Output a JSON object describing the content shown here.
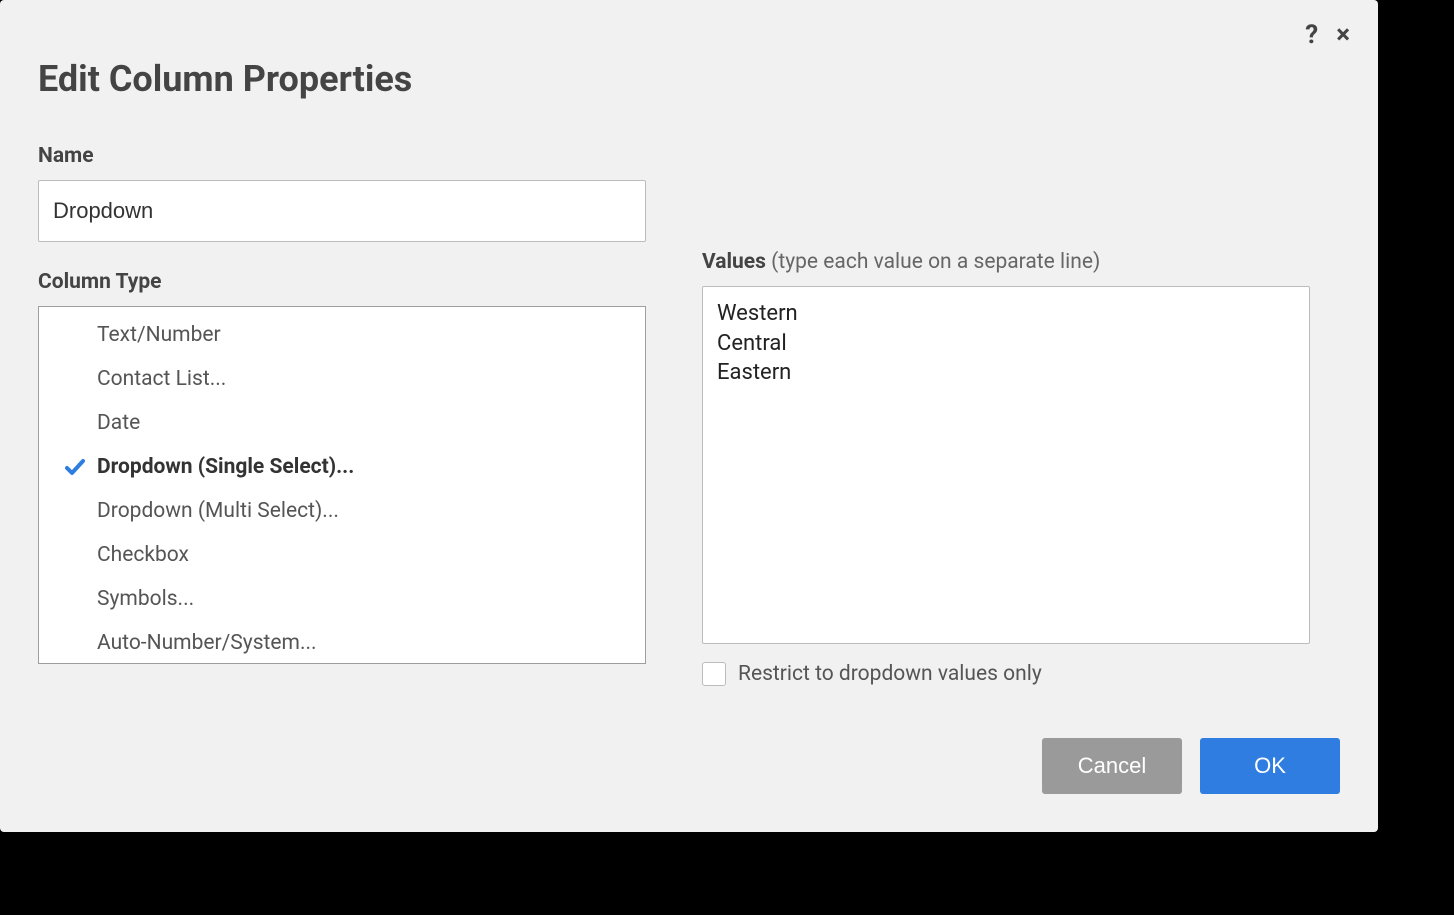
{
  "dialog": {
    "title": "Edit Column Properties",
    "help_icon": "?",
    "close_icon": "×"
  },
  "name_field": {
    "label": "Name",
    "value": "Dropdown"
  },
  "column_type": {
    "label": "Column Type",
    "selected_index": 3,
    "items": [
      "Text/Number",
      "Contact List...",
      "Date",
      "Dropdown (Single Select)...",
      "Dropdown (Multi Select)...",
      "Checkbox",
      "Symbols...",
      "Auto-Number/System..."
    ]
  },
  "values_field": {
    "label": "Values",
    "hint": " (type each value on a separate line)",
    "value": "Western\nCentral\nEastern"
  },
  "restrict": {
    "label": "Restrict to dropdown values only",
    "checked": false
  },
  "buttons": {
    "cancel": "Cancel",
    "ok": "OK"
  }
}
